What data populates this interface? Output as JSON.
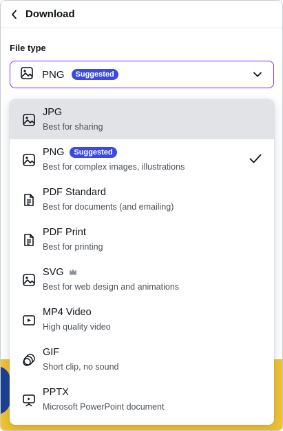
{
  "header": {
    "back_icon": "chevron-left-icon",
    "title": "Download"
  },
  "file_type": {
    "label": "File type",
    "selected": {
      "icon": "image-icon",
      "value": "PNG",
      "badge": "Suggested"
    },
    "chevron_icon": "chevron-down-icon",
    "accent_color": "#7d2ae8"
  },
  "options": [
    {
      "name": "JPG",
      "desc": "Best for sharing",
      "icon": "image-icon",
      "hovered": true
    },
    {
      "name": "PNG",
      "desc": "Best for complex images, illustrations",
      "icon": "image-icon",
      "badge": "Suggested",
      "selected": true,
      "check_icon": "check-icon"
    },
    {
      "name": "PDF Standard",
      "desc": "Best for documents (and emailing)",
      "icon": "document-icon"
    },
    {
      "name": "PDF Print",
      "desc": "Best for printing",
      "icon": "document-icon"
    },
    {
      "name": "SVG",
      "desc": "Best for web design and animations",
      "icon": "image-icon",
      "premium_icon": "crown-icon"
    },
    {
      "name": "MP4 Video",
      "desc": "High quality video",
      "icon": "video-icon"
    },
    {
      "name": "GIF",
      "desc": "Short clip, no sound",
      "icon": "gif-icon"
    },
    {
      "name": "PPTX",
      "desc": "Microsoft PowerPoint document",
      "icon": "presentation-icon"
    }
  ],
  "colors": {
    "badge": "#3b49df",
    "hover": "#e2e3e6",
    "background_art": "#f1c232"
  }
}
